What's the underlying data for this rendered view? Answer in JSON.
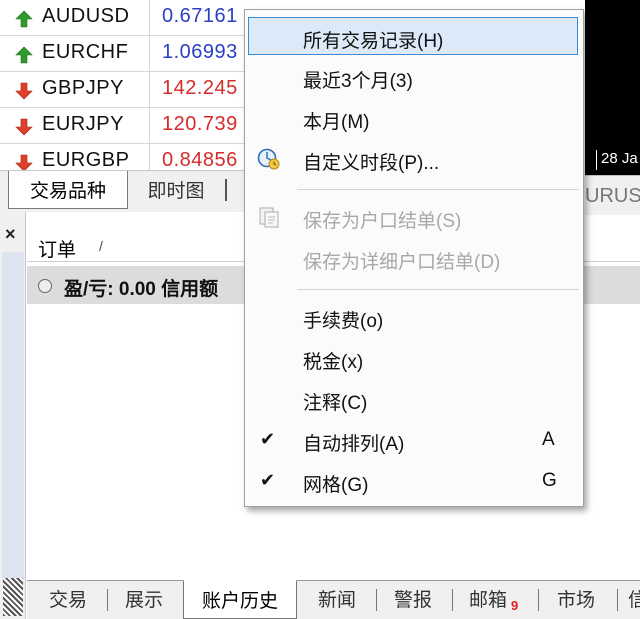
{
  "market_watch": {
    "rows": [
      {
        "symbol": "AUDUSD",
        "price": "0.67161",
        "direction": "up",
        "price_color": "#2b3fc2"
      },
      {
        "symbol": "EURCHF",
        "price": "1.06993",
        "direction": "up",
        "price_color": "#2b3fc2"
      },
      {
        "symbol": "GBPJPY",
        "price": "142.245",
        "direction": "down",
        "price_color": "#d62b2b"
      },
      {
        "symbol": "EURJPY",
        "price": "120.739",
        "direction": "down",
        "price_color": "#d62b2b"
      },
      {
        "symbol": "EURGBP",
        "price": "0.84856",
        "direction": "down",
        "price_color": "#d62b2b"
      }
    ],
    "tabs": [
      "交易品种",
      "即时图"
    ]
  },
  "chart": {
    "date_label": "28 Ja",
    "tab_label": "URUSD"
  },
  "toolbox": {
    "close_glyph": "×",
    "orders_title": "订单",
    "orders_sort_glyph": "/",
    "pl_text": "盈/亏: 0.00  信用额",
    "tabs": [
      {
        "label": "交易"
      },
      {
        "label": "展示"
      },
      {
        "label": "账户历史",
        "active": true
      },
      {
        "label": "新闻"
      },
      {
        "label": "警报"
      },
      {
        "label": "邮箱",
        "badge": "9"
      },
      {
        "label": "市场"
      },
      {
        "label": "信"
      }
    ]
  },
  "context_menu": {
    "items": [
      {
        "label": "所有交易记录(H)",
        "highlighted": true
      },
      {
        "label": "最近3个月(3)"
      },
      {
        "label": "本月(M)"
      },
      {
        "label": "自定义时段(P)...",
        "icon": "clock-icon"
      },
      {
        "label": "保存为户口结单(S)",
        "disabled": true,
        "icon": "save-report-icon"
      },
      {
        "label": "保存为详细户口结单(D)",
        "disabled": true
      },
      {
        "label": "手续费(o)"
      },
      {
        "label": "税金(x)"
      },
      {
        "label": "注释(C)"
      },
      {
        "label": "自动排列(A)",
        "checked": true,
        "accelerator": "A"
      },
      {
        "label": "网格(G)",
        "checked": true,
        "accelerator": "G"
      }
    ],
    "check_glyph": "✔"
  },
  "colors": {
    "up_arrow": "#2e9a2e",
    "down_arrow": "#e0402a",
    "menu_highlight": "#dce9f8",
    "menu_highlight_border": "#3c8ad0"
  }
}
